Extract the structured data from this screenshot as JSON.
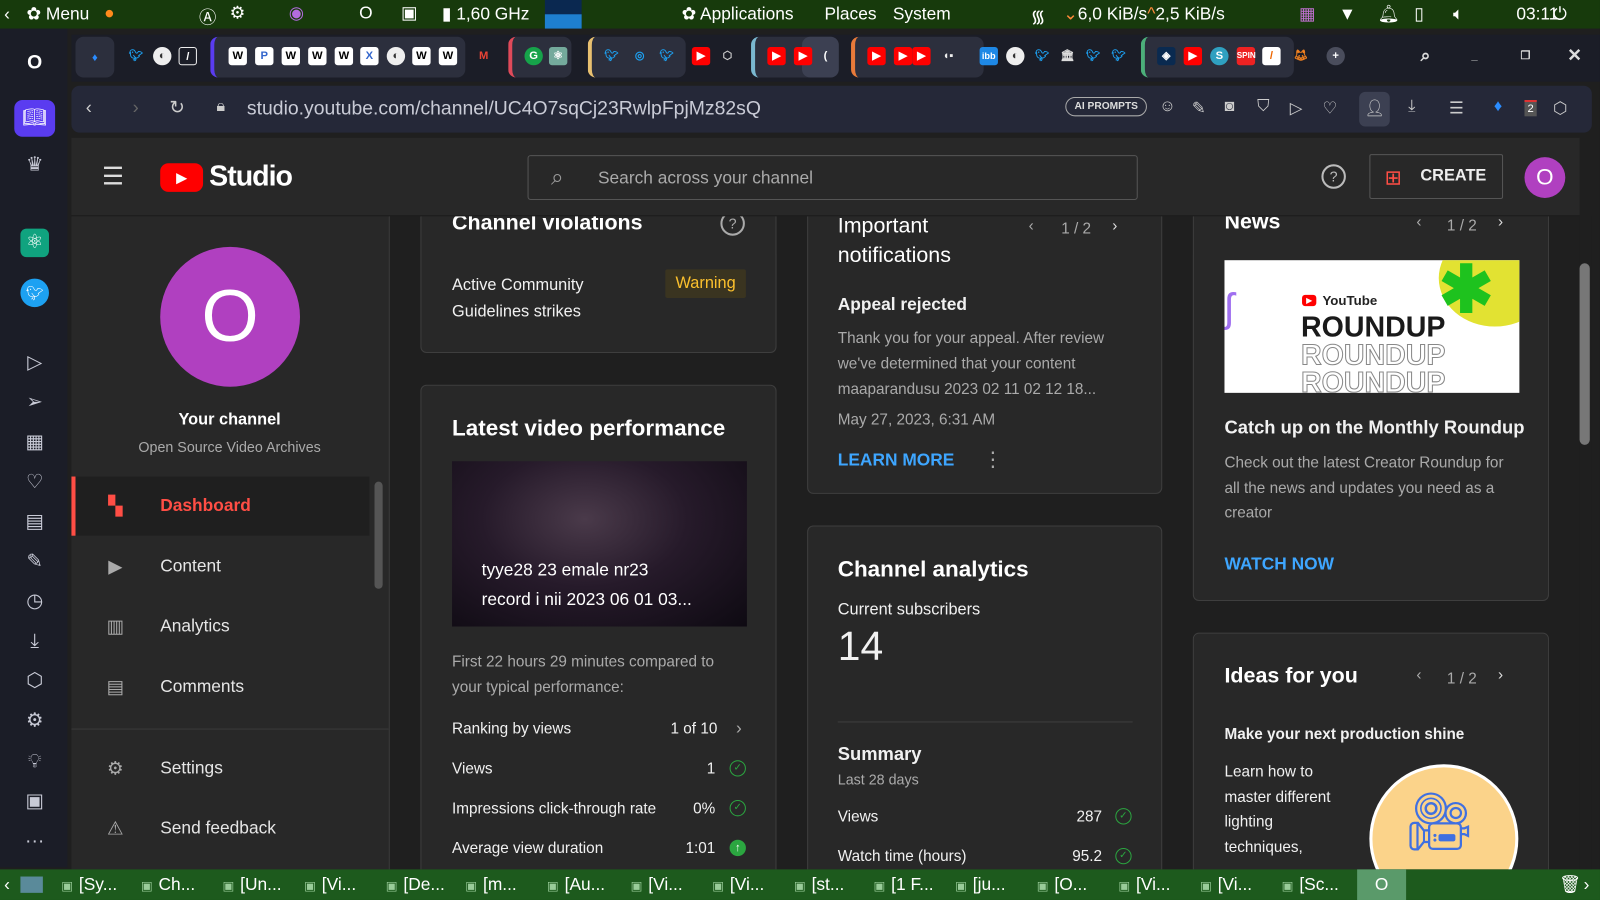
{
  "top_panel": {
    "menu": "Menu",
    "cpu": "1,60 GHz",
    "applications": "Applications",
    "places": "Places",
    "system": "System",
    "net_down": "6,0 KiB/s",
    "net_up": "2,5 KiB/s",
    "clock": "03:11"
  },
  "browser": {
    "url": "studio.youtube.com/channel/UC4O7sqCj23RwlpFpjMz82sQ",
    "ai_prompts": "AI PROMPTS",
    "tab_count_badge": "2"
  },
  "header": {
    "logo_text": "Studio",
    "search_placeholder": "Search across your channel",
    "create_label": "CREATE",
    "avatar_letter": "O"
  },
  "sidebar": {
    "avatar_letter": "O",
    "channel_label": "Your channel",
    "channel_name": "Open Source Video Archives",
    "items": [
      {
        "label": "Dashboard",
        "icon": "dashboard-icon"
      },
      {
        "label": "Content",
        "icon": "content-icon"
      },
      {
        "label": "Analytics",
        "icon": "analytics-icon"
      },
      {
        "label": "Comments",
        "icon": "comments-icon"
      }
    ],
    "bottom": [
      {
        "label": "Settings",
        "icon": "gear-icon"
      },
      {
        "label": "Send feedback",
        "icon": "feedback-icon"
      }
    ]
  },
  "violations": {
    "title": "Channel violations",
    "strikes_label_1": "Active Community",
    "strikes_label_2": "Guidelines strikes",
    "badge": "Warning"
  },
  "latest_video": {
    "title": "Latest video performance",
    "video_title_1": "tyye28 23 emale nr23",
    "video_title_2": "record i nii 2023 06 01 03...",
    "compare_1": "First 22 hours 29 minutes compared to",
    "compare_2": "your typical performance:",
    "rows": [
      {
        "label": "Ranking by views",
        "value": "1 of 10"
      },
      {
        "label": "Views",
        "value": "1"
      },
      {
        "label": "Impressions click-through rate",
        "value": "0%"
      },
      {
        "label": "Average view duration",
        "value": "1:01"
      }
    ]
  },
  "notifications": {
    "title_1": "Important",
    "title_2": "notifications",
    "pager": "1 / 2",
    "item_title": "Appeal rejected",
    "body_1": "Thank you for your appeal. After review",
    "body_2": "we've determined that your content",
    "body_3": "maaparandusu 2023 02 11 02 12 18...",
    "date": "May 27, 2023, 6:31 AM",
    "link": "LEARN MORE"
  },
  "analytics": {
    "title": "Channel analytics",
    "subs_label": "Current subscribers",
    "subs_value": "14",
    "summary": "Summary",
    "period": "Last 28 days",
    "rows": [
      {
        "label": "Views",
        "value": "287"
      },
      {
        "label": "Watch time (hours)",
        "value": "95.2"
      }
    ]
  },
  "news": {
    "title": "News",
    "pager": "1 / 2",
    "thumb_brand": "YouTube",
    "thumb_word": "ROUNDUP",
    "headline": "Catch up on the Monthly Roundup",
    "body_1": "Check out the latest Creator Roundup for",
    "body_2": "all the news and updates you need as a",
    "body_3": "creator",
    "link": "WATCH NOW"
  },
  "ideas": {
    "title": "Ideas for you",
    "pager": "1 / 2",
    "headline": "Make your next production shine",
    "body": [
      "Learn how to",
      "master different",
      "lighting",
      "techniques,"
    ]
  },
  "taskbar": [
    "[Sy...",
    "Ch...",
    "[Un...",
    "[Vi...",
    "[De...",
    "[m...",
    "[Au...",
    "[Vi...",
    "[Vi...",
    "[st...",
    "[1 F...",
    "[ju...",
    "[O...",
    "[Vi...",
    "[Vi...",
    "[Sc..."
  ]
}
